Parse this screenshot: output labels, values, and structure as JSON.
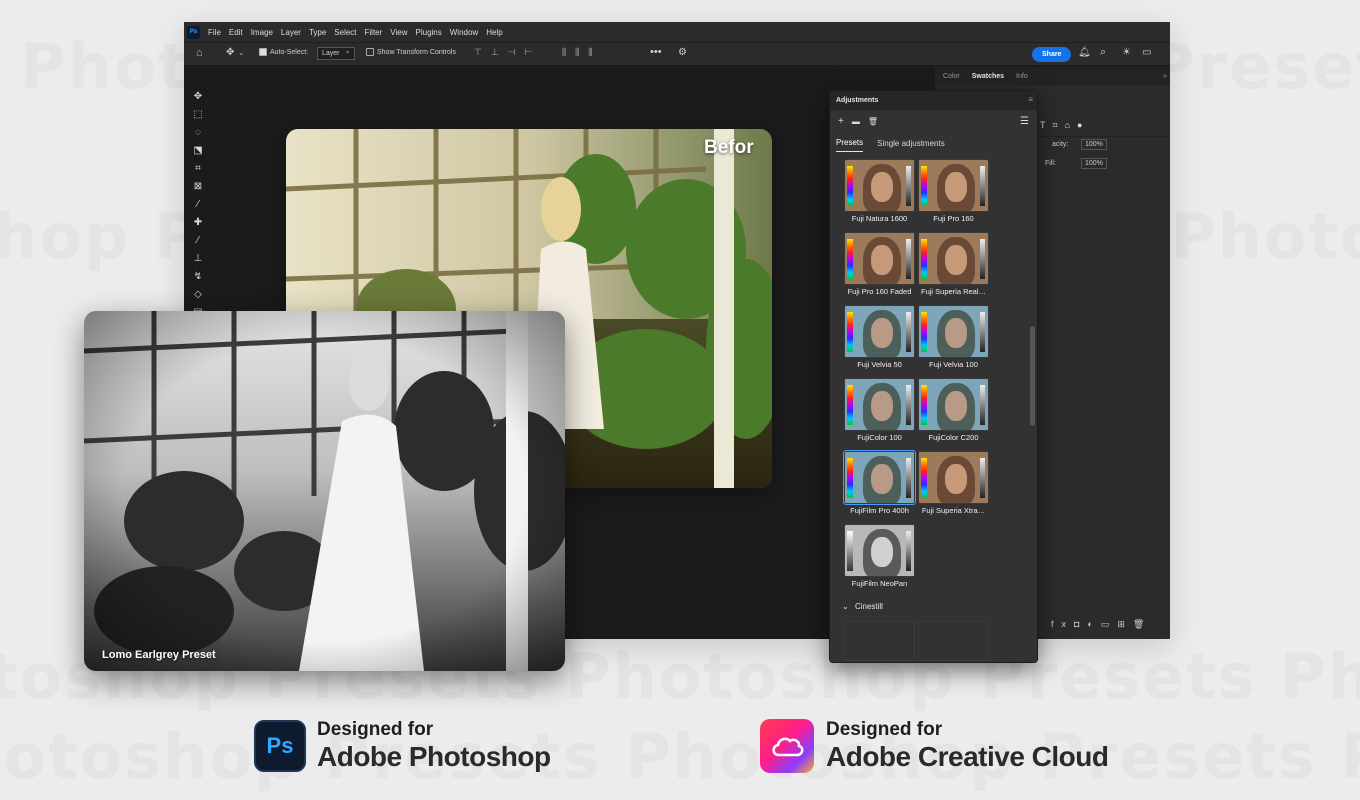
{
  "watermark_text": "Photoshop Presets Photoshop Presets Photoshop Presets",
  "menu": [
    "File",
    "Edit",
    "Image",
    "Layer",
    "Type",
    "Select",
    "Filter",
    "View",
    "Plugins",
    "Window",
    "Help"
  ],
  "options": {
    "auto_select_label": "Auto-Select:",
    "auto_select_value": "Layer",
    "show_transform_label": "Show Transform Controls",
    "share_label": "Share"
  },
  "dock": {
    "tabs": [
      "Color",
      "Swatches",
      "Info"
    ],
    "active_tab": "Swatches",
    "opacity_label": "acity:",
    "opacity_value": "100%",
    "fill_label": "Fill:",
    "fill_value": "100%"
  },
  "images": {
    "before_label": "Befor",
    "after_label": "Lomo Earlgrey Preset"
  },
  "adjustments": {
    "title": "Adjustments",
    "tabs": [
      "Presets",
      "Single adjustments"
    ],
    "active_tab": "Presets",
    "presets": [
      {
        "name": "Fuji Natura 1600",
        "tone": "warm"
      },
      {
        "name": "Fuji Pro 160",
        "tone": "warm"
      },
      {
        "name": "Fuji Pro 160 Faded",
        "tone": "warm"
      },
      {
        "name": "Fuji Superia Real…",
        "tone": "warm"
      },
      {
        "name": "Fuji Velvia 50",
        "tone": "cool"
      },
      {
        "name": "Fuji Velvia 100",
        "tone": "cool"
      },
      {
        "name": "FujiColor 100",
        "tone": "cool"
      },
      {
        "name": "FujiColor C200",
        "tone": "cool"
      },
      {
        "name": "FujiFilm Pro 400h",
        "tone": "cool",
        "selected": true
      },
      {
        "name": "Fuji Superia Xtra…",
        "tone": "warm"
      },
      {
        "name": "FujiFilm NeoPan",
        "tone": "mono"
      }
    ],
    "group_label": "Cinestill"
  },
  "badges": [
    {
      "line1": "Designed for",
      "line2": "Adobe Photoshop",
      "icon": "photoshop-logo",
      "icon_text": "Ps"
    },
    {
      "line1": "Designed for",
      "line2": "Adobe Creative Cloud",
      "icon": "creative-cloud-logo"
    }
  ]
}
